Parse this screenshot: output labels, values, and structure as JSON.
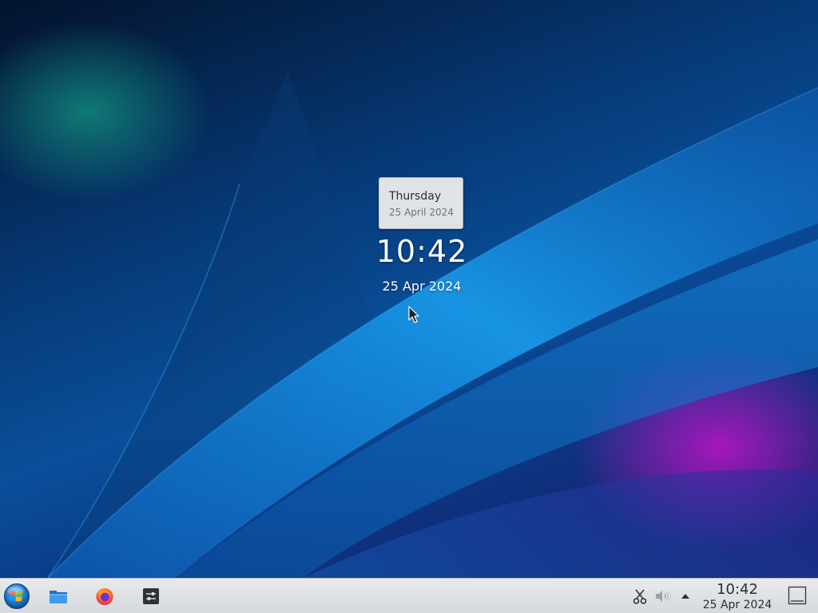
{
  "desktop": {
    "clock": {
      "time": "10:42",
      "date": "25 Apr 2024"
    },
    "tooltip": {
      "day": "Thursday",
      "full_date": "25 April 2024"
    }
  },
  "taskbar": {
    "launchers": [
      {
        "name": "start-menu",
        "icon": "windows-orb-icon"
      },
      {
        "name": "file-manager",
        "icon": "folder-icon"
      },
      {
        "name": "firefox",
        "icon": "firefox-icon"
      },
      {
        "name": "settings",
        "icon": "settings-icon"
      }
    ],
    "tray": {
      "icons": [
        "clipboard-icon",
        "volume-icon",
        "expand-arrow-icon"
      ]
    },
    "clock": {
      "time": "10:42",
      "date": "25 Apr 2024"
    }
  },
  "colors": {
    "taskbar_bg": "#dcdfe3",
    "tooltip_bg": "#dfe3e8",
    "accent_blue": "#1a8fe0",
    "accent_magenta": "#b416c8"
  }
}
